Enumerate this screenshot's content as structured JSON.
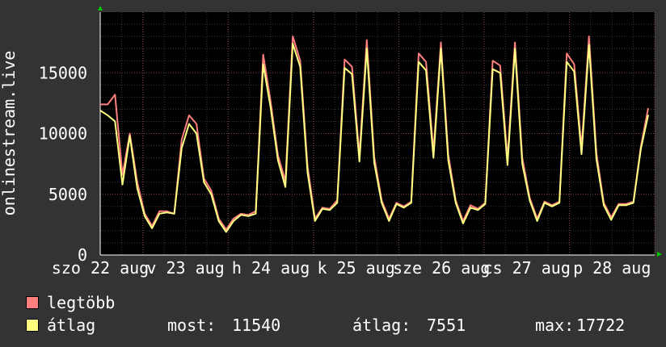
{
  "chart_data": {
    "type": "line",
    "ylabel": "onlinestream.live",
    "y_ticks": [
      0,
      5000,
      10000,
      15000
    ],
    "ylim": [
      0,
      20000
    ],
    "x_ticks": [
      "szo 22 aug",
      "v 23 aug",
      "h 24 aug",
      "k 25 aug",
      "sze 26 aug",
      "cs 27 aug",
      "p 28 aug"
    ],
    "x_days": 6.5,
    "grid": true,
    "series": [
      {
        "name": "legtöbb",
        "color": "#ff7f7f",
        "values": [
          12400,
          12400,
          13200,
          6600,
          10000,
          6000,
          3400,
          2400,
          3600,
          3600,
          3400,
          9500,
          11500,
          10800,
          6300,
          5300,
          3000,
          2100,
          3000,
          3400,
          3300,
          3600,
          16500,
          12700,
          8200,
          6100,
          18000,
          16000,
          7300,
          3000,
          3900,
          3800,
          4500,
          16100,
          15500,
          8200,
          17700,
          8100,
          4500,
          3000,
          4300,
          4000,
          4400,
          16600,
          15900,
          8500,
          17500,
          8300,
          4500,
          2800,
          4100,
          3800,
          4300,
          16000,
          15600,
          7900,
          17500,
          8000,
          4700,
          3000,
          4400,
          4100,
          4400,
          16600,
          15700,
          8800,
          18000,
          8400,
          4300,
          3100,
          4200,
          4200,
          4400,
          8900,
          12100
        ]
      },
      {
        "name": "átlag",
        "color": "#ffff80",
        "values": [
          11900,
          11500,
          11000,
          5800,
          9800,
          5500,
          3200,
          2200,
          3400,
          3500,
          3400,
          8800,
          10800,
          10000,
          6000,
          5000,
          2800,
          1900,
          2800,
          3300,
          3200,
          3400,
          15700,
          12200,
          7800,
          5600,
          17400,
          15500,
          6800,
          2800,
          3800,
          3700,
          4300,
          15400,
          14900,
          7700,
          17000,
          7600,
          4300,
          2800,
          4200,
          3900,
          4300,
          15900,
          15200,
          8000,
          17000,
          7800,
          4300,
          2600,
          3900,
          3700,
          4200,
          15300,
          15000,
          7400,
          17000,
          7500,
          4500,
          2800,
          4300,
          4000,
          4300,
          15900,
          15100,
          8300,
          17300,
          7900,
          4100,
          2900,
          4100,
          4100,
          4300,
          8700,
          11540
        ]
      }
    ],
    "stats": [
      {
        "label": "most:",
        "value": "11540"
      },
      {
        "label": "átlag:",
        "value": "7551"
      },
      {
        "label": "max:",
        "value": "17722"
      }
    ]
  }
}
